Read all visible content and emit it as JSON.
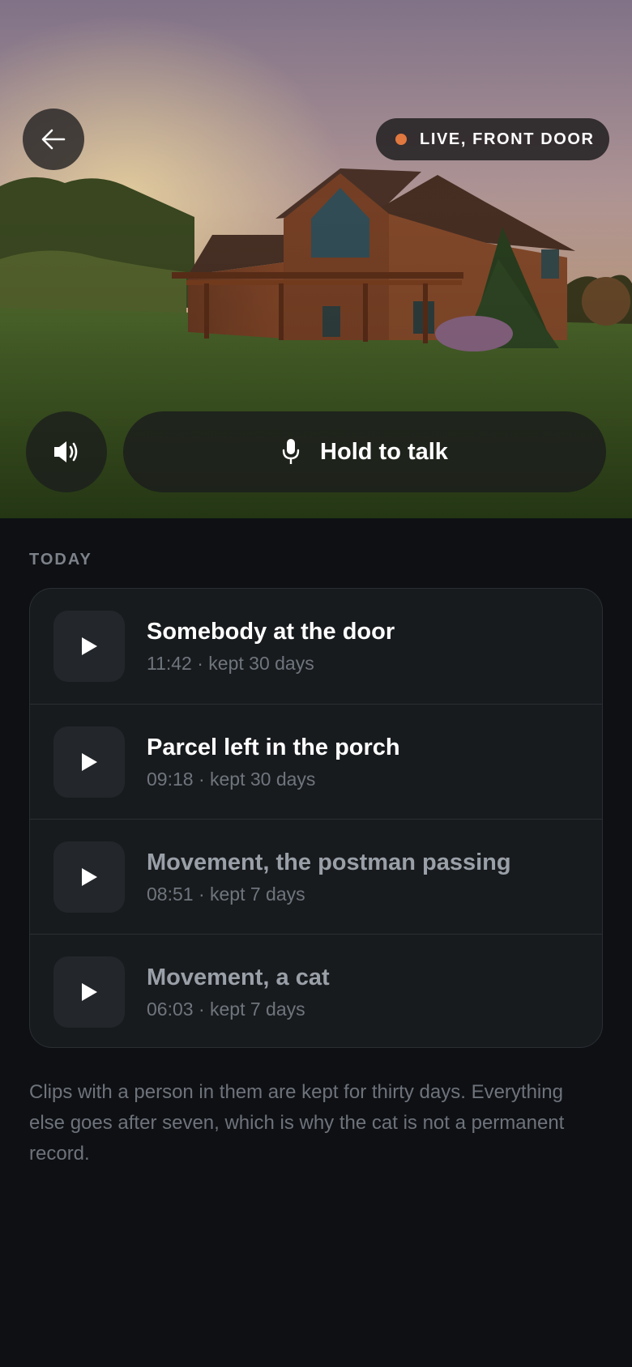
{
  "feed": {
    "live_label": "LIVE, FRONT DOOR",
    "live_color": "#e0783f",
    "back_icon": "arrow-left-icon",
    "volume_icon": "speaker-icon",
    "talk": {
      "label": "Hold to talk",
      "icon": "microphone-icon"
    }
  },
  "clips": {
    "section_title": "TODAY",
    "items": [
      {
        "title": "Somebody at the door",
        "meta": "11:42 · kept 30 days",
        "icon": "play-icon"
      },
      {
        "title": "Parcel left in the porch",
        "meta": "09:18 · kept 30 days",
        "icon": "play-icon"
      },
      {
        "title": "Movement, the postman passing",
        "meta": "08:51 · kept 7 days",
        "icon": "play-icon"
      },
      {
        "title": "Movement, a cat",
        "meta": "06:03 · kept 7 days",
        "icon": "play-icon"
      }
    ]
  },
  "footnote": "Clips with a person in them are kept for thirty days. Everything else goes after seven, which is why the cat is not a permanent record."
}
